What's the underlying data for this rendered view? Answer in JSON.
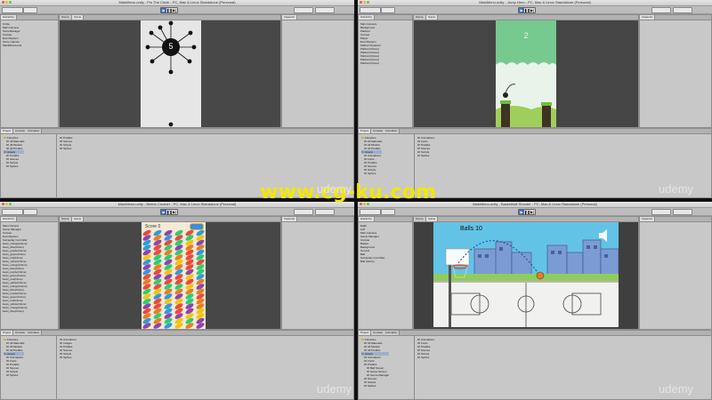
{
  "watermark": "www.cg-ku.com",
  "brand": "udemy",
  "windows": [
    {
      "title": "MainMenu.unity - Pin The Circle - PC, Mac & Linux Standalone (Personal)",
      "tabs": [
        "Hierarchy",
        "Scene",
        "Game",
        "Inspector"
      ],
      "hierarchy": [
        "Circle",
        "Main Camera",
        "ScoreManager",
        "Canvas",
        "EventSystem",
        "Score Canvas",
        "MainMenuLevel"
      ],
      "score": "5",
      "project_tabs": [
        "Project",
        "Console",
        "Animation"
      ],
      "project_tree": [
        "Favorites",
        "All Materials",
        "All Models",
        "All Prefabs",
        "Assets",
        "Prefabs",
        "Scenes",
        "Scripts",
        "Sprites"
      ],
      "assets": [
        "Prefabs",
        "Scenes",
        "Scripts",
        "Sprites"
      ]
    },
    {
      "title": "MainMenu.unity - Jump Hero - PC, Mac & Linux Standalone (Personal)",
      "tabs": [
        "Hierarchy",
        "Scene",
        "Game",
        "Inspector"
      ],
      "hierarchy": [
        "Main Camera",
        "Background",
        "Platform",
        "Canvas",
        "Player",
        "EventSystem",
        "PlatformSpawner",
        "Platform(Clone)",
        "Platform(Clone)",
        "Platform(Clone)",
        "Platform(Clone)",
        "Platform(Clone)"
      ],
      "score": "2",
      "project_tabs": [
        "Project",
        "Console",
        "Animation"
      ],
      "project_tree": [
        "Favorites",
        "All Materials",
        "All Models",
        "All Prefabs",
        "Assets",
        "Animations",
        "Fonts",
        "Prefabs",
        "Scenes",
        "Scripts",
        "Sprites"
      ],
      "assets": [
        "Animations",
        "Fonts",
        "Prefabs",
        "Scenes",
        "Scripts",
        "Sprites"
      ]
    },
    {
      "title": "MainMenu.unity - Beans Crusher - PC, Mac & Linux Standalone (Personal)",
      "tabs": [
        "Hierarchy",
        "Scene",
        "Game",
        "Inspector"
      ],
      "hierarchy": [
        "Main Camera",
        "Game Manager",
        "Canvas",
        "EventSystem",
        "Gameplay Controller",
        "bean_orange(Clone)",
        "bean_blue(Clone)",
        "bean_purple(Clone)",
        "bean_green(Clone)",
        "bean_red(Clone)",
        "bean_yellow(Clone)",
        "bean_orange(Clone)",
        "bean_blue(Clone)",
        "bean_purple(Clone)",
        "bean_green(Clone)",
        "bean_red(Clone)",
        "bean_yellow(Clone)",
        "bean_orange(Clone)",
        "bean_blue(Clone)",
        "bean_purple(Clone)",
        "bean_green(Clone)",
        "bean_red(Clone)",
        "bean_yellow(Clone)",
        "bean_orange(Clone)",
        "bean_blue(Clone)"
      ],
      "score_label": "Score 0",
      "project_tabs": [
        "Project",
        "Console",
        "Animation"
      ],
      "project_tree": [
        "Favorites",
        "All Materials",
        "All Models",
        "All Prefabs",
        "Assets",
        "Animations",
        "Fonts",
        "Prefabs",
        "Scenes",
        "Scripts",
        "Sprites"
      ],
      "assets": [
        "Animations",
        "Images",
        "Prefabs",
        "Scenes",
        "Scripts",
        "Sprites"
      ]
    },
    {
      "title": "MainMenu.unity - Basketball Shooter - PC, Mac & Linux Standalone (Personal)",
      "tabs": [
        "Hierarchy",
        "Scene",
        "Game",
        "Inspector"
      ],
      "hierarchy": [
        "Right",
        "Left",
        "Main Camera",
        "Game Manager",
        "Canvas",
        "Basket",
        "Background",
        "Ground",
        "Ball",
        "Gameplay Controller",
        "Ball (Clone)"
      ],
      "balls_label": "Balls 10",
      "project_tabs": [
        "Project",
        "Console",
        "Animation"
      ],
      "project_tree": [
        "Favorites",
        "All Materials",
        "All Models",
        "All Prefabs",
        "Assets",
        "Animations",
        "Fonts",
        "Prefabs",
        "Ball Screen",
        "Game Screen",
        "Scene Manager",
        "Scenes",
        "Scripts",
        "Sprites"
      ],
      "assets": [
        "Animations",
        "Fonts",
        "Prefabs",
        "Scenes",
        "Scripts",
        "Sprites"
      ]
    }
  ]
}
